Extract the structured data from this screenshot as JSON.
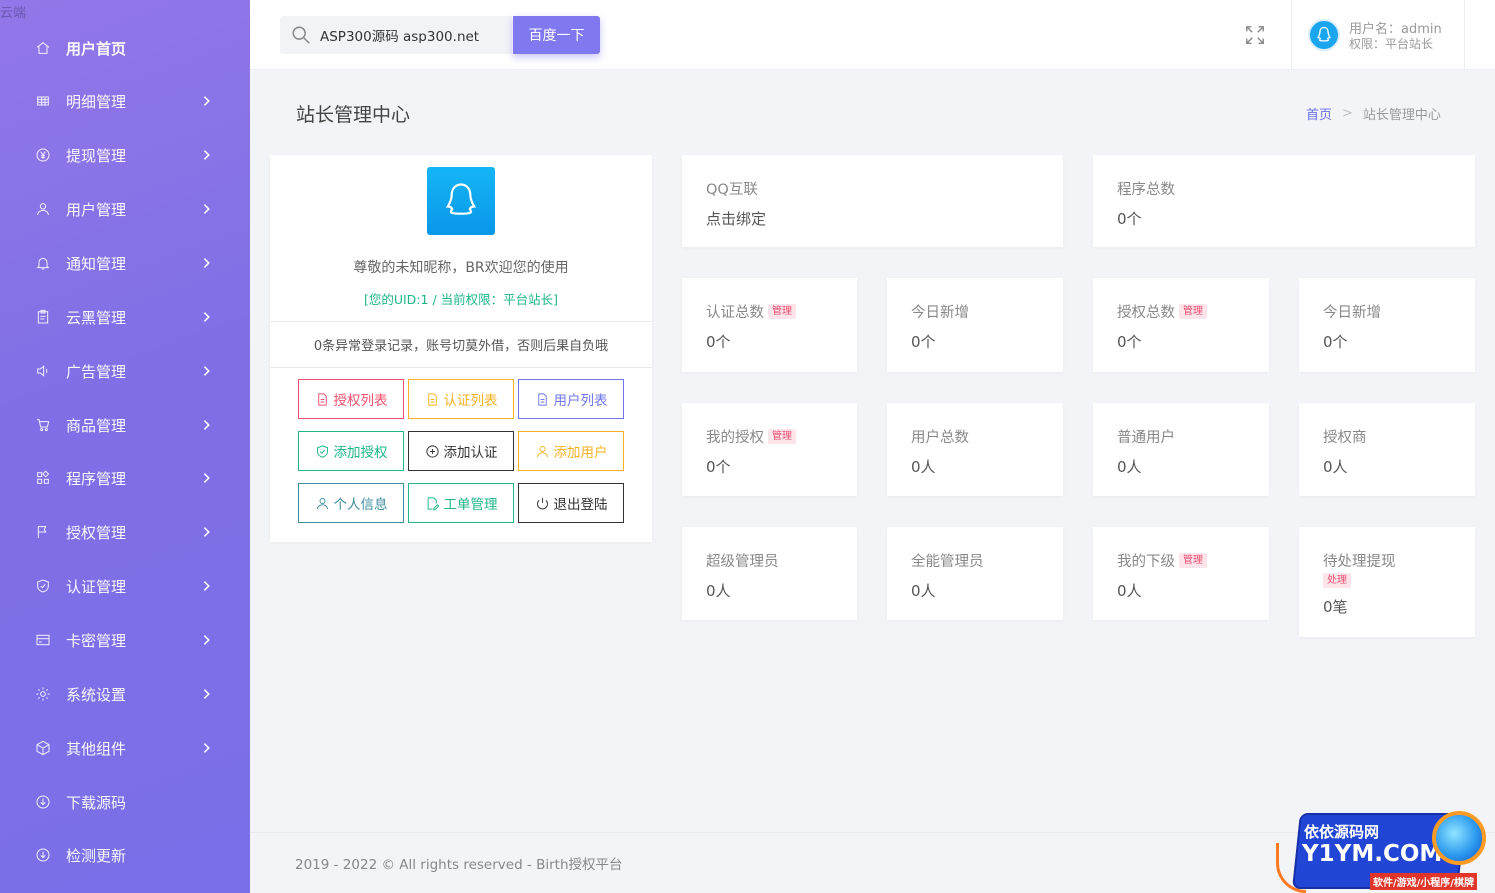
{
  "brand": "云端",
  "sidebar": {
    "items": [
      {
        "label": "用户首页",
        "icon": "home-icon",
        "has_arrow": false
      },
      {
        "label": "明细管理",
        "icon": "grid-icon",
        "has_arrow": true
      },
      {
        "label": "提现管理",
        "icon": "yen-icon",
        "has_arrow": true
      },
      {
        "label": "用户管理",
        "icon": "user-icon",
        "has_arrow": true
      },
      {
        "label": "通知管理",
        "icon": "bell-icon",
        "has_arrow": true
      },
      {
        "label": "云黑管理",
        "icon": "clipboard-icon",
        "has_arrow": true
      },
      {
        "label": "广告管理",
        "icon": "speaker-icon",
        "has_arrow": true
      },
      {
        "label": "商品管理",
        "icon": "cart-icon",
        "has_arrow": true
      },
      {
        "label": "程序管理",
        "icon": "apps-icon",
        "has_arrow": true
      },
      {
        "label": "授权管理",
        "icon": "flag-icon",
        "has_arrow": true
      },
      {
        "label": "认证管理",
        "icon": "shield-check-icon",
        "has_arrow": true
      },
      {
        "label": "卡密管理",
        "icon": "card-icon",
        "has_arrow": true
      },
      {
        "label": "系统设置",
        "icon": "gear-icon",
        "has_arrow": true
      },
      {
        "label": "其他组件",
        "icon": "cube-icon",
        "has_arrow": true
      },
      {
        "label": "下载源码",
        "icon": "download-icon",
        "has_arrow": false
      },
      {
        "label": "检测更新",
        "icon": "update-icon",
        "has_arrow": false
      }
    ]
  },
  "header": {
    "search_value": "ASP300源码 asp300.net",
    "search_button": "百度一下",
    "username_label": "用户名：",
    "username": "admin",
    "role_label": "权限：",
    "role": "平台站长"
  },
  "page": {
    "title": "站长管理中心",
    "breadcrumb_home": "首页",
    "breadcrumb_sep": ">",
    "breadcrumb_current": "站长管理中心"
  },
  "profile": {
    "welcome": "尊敬的未知昵称，BR欢迎您的使用",
    "uid_line": "[您的UID:1 / 当前权限：平台站长]",
    "login_notice": "0条异常登录记录，账号切莫外借，否则后果自负哦",
    "buttons": [
      {
        "label": "授权列表",
        "color": "#f0506e"
      },
      {
        "label": "认证列表",
        "color": "#f5b225"
      },
      {
        "label": "用户列表",
        "color": "#7075ea"
      },
      {
        "label": "添加授权",
        "color": "#1fb68a"
      },
      {
        "label": "添加认证",
        "color": "#333333"
      },
      {
        "label": "添加用户",
        "color": "#f5b225"
      },
      {
        "label": "个人信息",
        "color": "#3e8e9e"
      },
      {
        "label": "工单管理",
        "color": "#1fb68a"
      },
      {
        "label": "退出登陆",
        "color": "#333333"
      }
    ]
  },
  "stats": [
    {
      "title": "QQ互联",
      "value": "点击绑定",
      "badge": ""
    },
    {
      "title": "程序总数",
      "value": "0个",
      "badge": ""
    },
    {
      "title": "认证总数",
      "value": "0个",
      "badge": "管理"
    },
    {
      "title": "今日新增",
      "value": "0个",
      "badge": ""
    },
    {
      "title": "授权总数",
      "value": "0个",
      "badge": "管理"
    },
    {
      "title": "今日新增",
      "value": "0个",
      "badge": ""
    },
    {
      "title": "我的授权",
      "value": "0个",
      "badge": "管理"
    },
    {
      "title": "用户总数",
      "value": "0人",
      "badge": ""
    },
    {
      "title": "普通用户",
      "value": "0人",
      "badge": ""
    },
    {
      "title": "授权商",
      "value": "0人",
      "badge": ""
    },
    {
      "title": "超级管理员",
      "value": "0人",
      "badge": ""
    },
    {
      "title": "全能管理员",
      "value": "0人",
      "badge": ""
    },
    {
      "title": "我的下级",
      "value": "0人",
      "badge": "管理"
    },
    {
      "title": "待处理提现",
      "value": "0笔",
      "badge": "处理"
    }
  ],
  "footer": "2019 - 2022 © All rights reserved - Birth授权平台",
  "watermark": {
    "line1": "依依源码网",
    "line2": "Y1YM.COM",
    "line3": "软件/游戏/小程序/棋牌"
  }
}
